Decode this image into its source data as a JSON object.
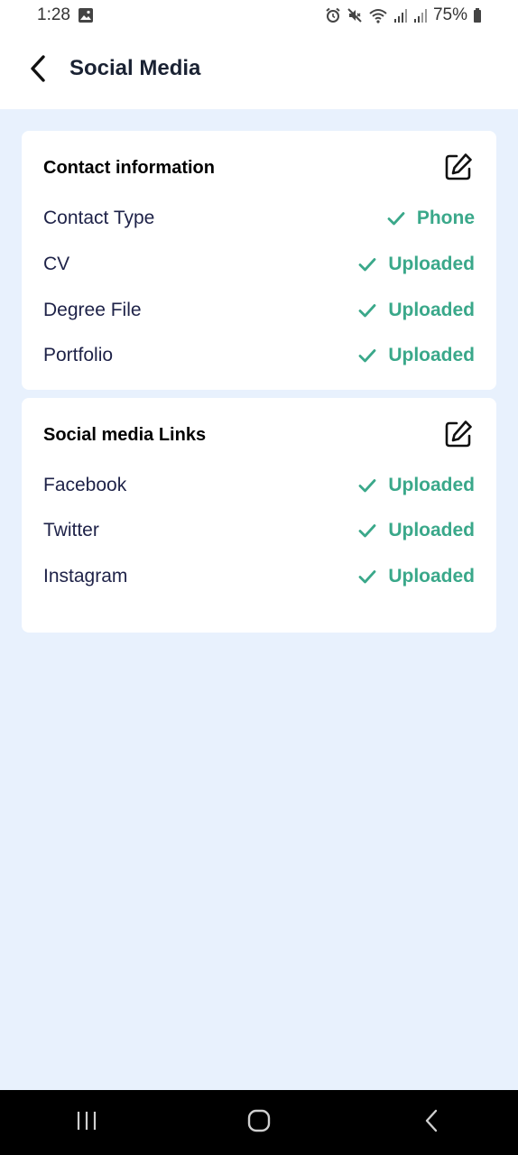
{
  "status_bar": {
    "time": "1:28",
    "battery": "75%",
    "icons": [
      "image-icon",
      "alarm-icon",
      "mute-icon",
      "wifi-icon",
      "signal-icon",
      "signal-icon",
      "battery-icon"
    ]
  },
  "app_bar": {
    "title": "Social Media",
    "back_icon": "back-arrow-icon"
  },
  "contact_card": {
    "title": "Contact information",
    "edit_icon": "edit-icon",
    "rows": [
      {
        "label": "Contact Type",
        "value": "Phone"
      },
      {
        "label": "CV",
        "value": "Uploaded"
      },
      {
        "label": "Degree File",
        "value": "Uploaded"
      },
      {
        "label": "Portfolio",
        "value": "Uploaded"
      }
    ]
  },
  "social_card": {
    "title": "Social media Links",
    "edit_icon": "edit-icon",
    "rows": [
      {
        "label": "Facebook",
        "value": "Uploaded"
      },
      {
        "label": "Twitter",
        "value": "Uploaded"
      },
      {
        "label": "Instagram",
        "value": "Uploaded"
      }
    ]
  },
  "colors": {
    "accent": "#3aa88a",
    "background": "#e8f1fd",
    "label": "#1e2248"
  },
  "nav_bar": {
    "icons": [
      "recents-icon",
      "home-icon",
      "back-icon"
    ]
  }
}
